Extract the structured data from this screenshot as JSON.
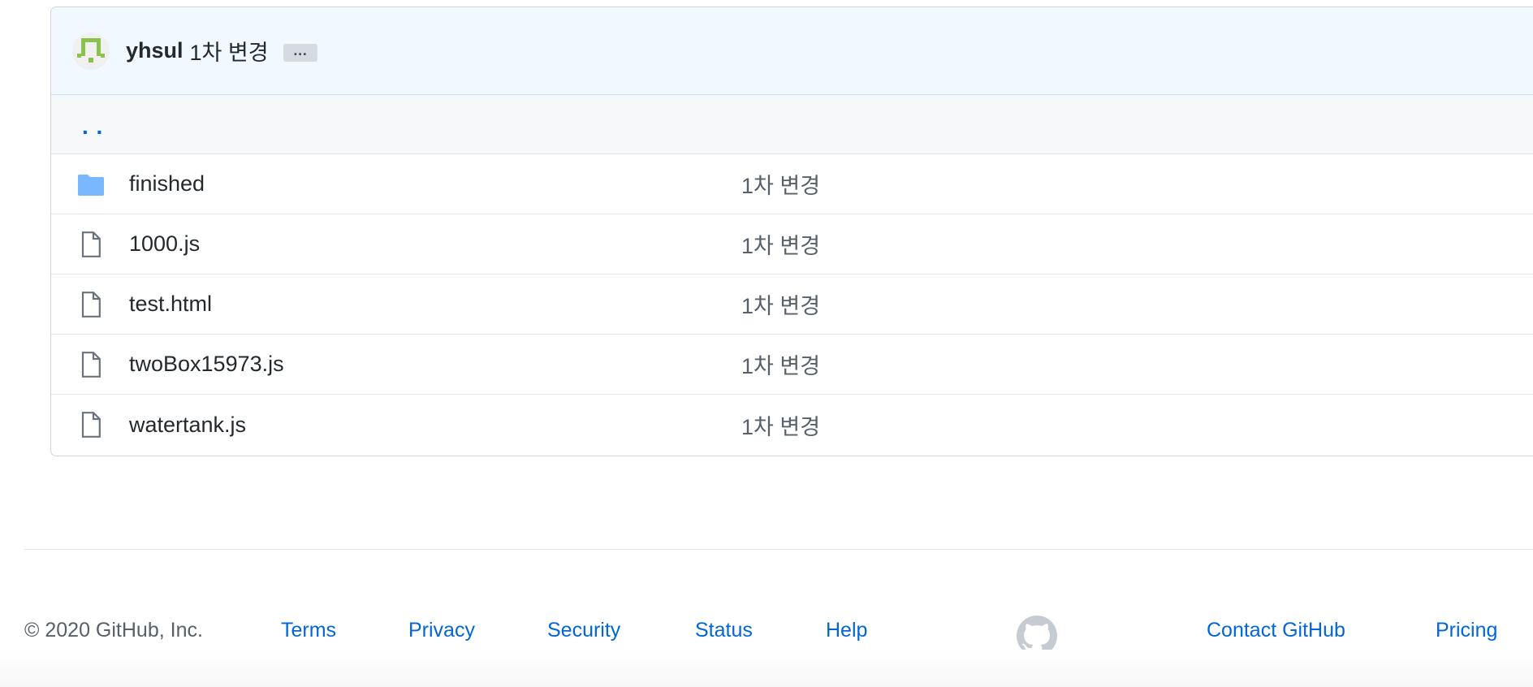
{
  "commit_header": {
    "author": "yhsul",
    "message": "1차 변경",
    "ellipsis_label": "…"
  },
  "up_link": {
    "label": ". ."
  },
  "files": [
    {
      "name": "finished",
      "type": "folder",
      "commit": "1차 변경",
      "icon": "folder-icon"
    },
    {
      "name": "1000.js",
      "type": "file",
      "commit": "1차 변경",
      "icon": "file-icon"
    },
    {
      "name": "test.html",
      "type": "file",
      "commit": "1차 변경",
      "icon": "file-icon"
    },
    {
      "name": "twoBox15973.js",
      "type": "file",
      "commit": "1차 변경",
      "icon": "file-icon"
    },
    {
      "name": "watertank.js",
      "type": "file",
      "commit": "1차 변경",
      "icon": "file-icon"
    }
  ],
  "footer": {
    "copyright": "© 2020 GitHub, Inc.",
    "links": {
      "terms": "Terms",
      "privacy": "Privacy",
      "security": "Security",
      "status": "Status",
      "help": "Help",
      "contact": "Contact GitHub",
      "pricing": "Pricing"
    },
    "logo_icon": "github-mark-icon"
  },
  "colors": {
    "link": "#0366d6",
    "folder": "#79b8ff",
    "header_bg": "#f1f8ff"
  }
}
